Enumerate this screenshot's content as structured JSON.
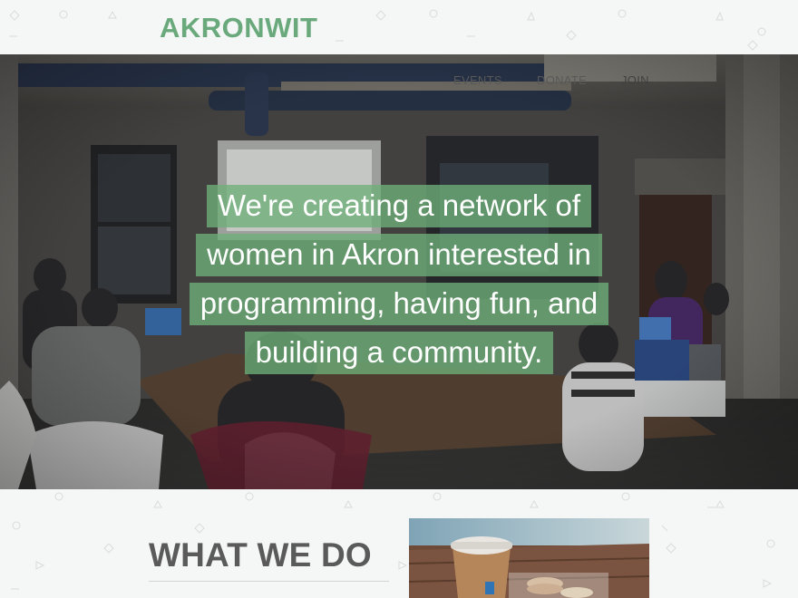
{
  "site": {
    "logo": "AKRONWIT",
    "accent_color": "#6aa97c"
  },
  "nav": {
    "items": [
      {
        "label": "EVENTS"
      },
      {
        "label": "DONATE"
      },
      {
        "label": "JOIN"
      }
    ]
  },
  "hero": {
    "tagline": "We're creating a network of women in Akron interested in programming, having fun, and building a community.",
    "highlight_color": "#6eaf78"
  },
  "section": {
    "title": "WHAT WE DO"
  }
}
